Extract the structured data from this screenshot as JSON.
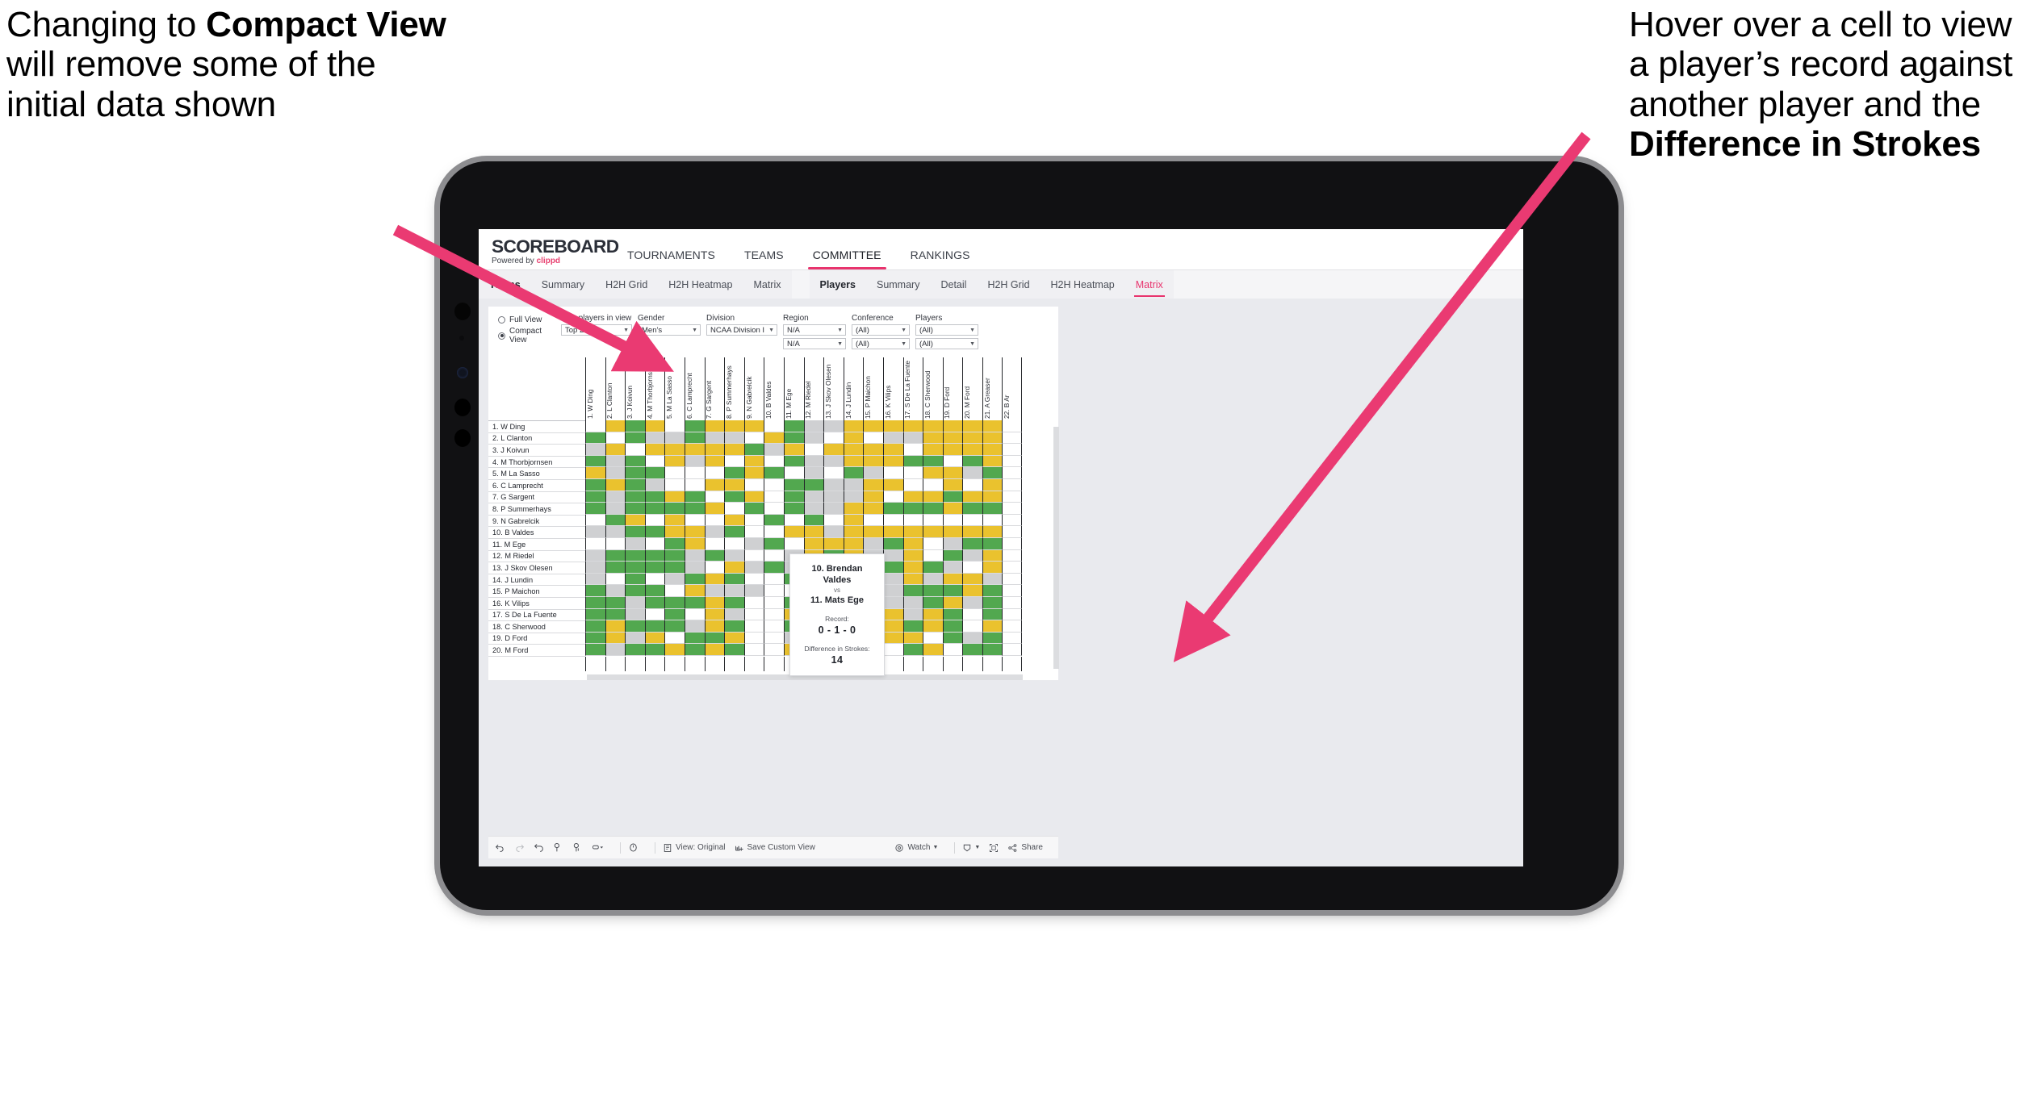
{
  "annotations": {
    "left": {
      "lines": [
        "Changing to ",
        "Compact View",
        " will remove some of the initial data shown"
      ],
      "plain_pre": "Changing to ",
      "bold": "Compact View",
      "plain_post": " will remove some of the initial data shown"
    },
    "right": {
      "plain_pre": "Hover over a cell to view a player’s record against another player and the ",
      "bold": "Difference in Strokes",
      "plain_post": ""
    },
    "arrow_color": "#ea3a72"
  },
  "app": {
    "brand": {
      "name": "SCOREBOARD",
      "powered_prefix": "Powered by ",
      "powered_brand": "clippd"
    },
    "topnav": [
      {
        "label": "TOURNAMENTS",
        "active": false
      },
      {
        "label": "TEAMS",
        "active": false
      },
      {
        "label": "COMMITTEE",
        "active": true
      },
      {
        "label": "RANKINGS",
        "active": false
      }
    ],
    "subnav_teams": [
      {
        "label": "Teams",
        "head": true,
        "selected": false
      },
      {
        "label": "Summary",
        "head": false,
        "selected": false
      },
      {
        "label": "H2H Grid",
        "head": false,
        "selected": false
      },
      {
        "label": "H2H Heatmap",
        "head": false,
        "selected": false
      },
      {
        "label": "Matrix",
        "head": false,
        "selected": false
      }
    ],
    "subnav_players": [
      {
        "label": "Players",
        "head": true,
        "selected": false
      },
      {
        "label": "Summary",
        "head": false,
        "selected": false
      },
      {
        "label": "Detail",
        "head": false,
        "selected": false
      },
      {
        "label": "H2H Grid",
        "head": false,
        "selected": false
      },
      {
        "label": "H2H Heatmap",
        "head": false,
        "selected": false
      },
      {
        "label": "Matrix",
        "head": false,
        "selected": true
      }
    ]
  },
  "filters": {
    "view_modes": [
      {
        "label": "Full View",
        "selected": false
      },
      {
        "label": "Compact View",
        "selected": true
      }
    ],
    "fields": [
      {
        "name": "max_players",
        "label": "Max players in view",
        "value": "Top 25",
        "value2": null
      },
      {
        "name": "gender",
        "label": "Gender",
        "value": "Men’s",
        "value2": null
      },
      {
        "name": "division",
        "label": "Division",
        "value": "NCAA Division I",
        "value2": null
      },
      {
        "name": "region",
        "label": "Region",
        "value": "N/A",
        "value2": "N/A"
      },
      {
        "name": "conference",
        "label": "Conference",
        "value": "(All)",
        "value2": "(All)"
      },
      {
        "name": "players",
        "label": "Players",
        "value": "(All)",
        "value2": "(All)"
      }
    ]
  },
  "matrix": {
    "row_labels": [
      "1. W Ding",
      "2. L Clanton",
      "3. J Koivun",
      "4. M Thorbjornsen",
      "5. M La Sasso",
      "6. C Lamprecht",
      "7. G Sargent",
      "8. P Summerhays",
      "9. N Gabrelcik",
      "10. B Valdes",
      "11. M Ege",
      "12. M Riedel",
      "13. J Skov Olesen",
      "14. J Lundin",
      "15. P Maichon",
      "16. K Vilips",
      "17. S De La Fuente",
      "18. C Sherwood",
      "19. D Ford",
      "20. M Ford"
    ],
    "col_labels": [
      "1. W Ding",
      "2. L Clanton",
      "3. J Koivun",
      "4. M Thorbjornsen",
      "5. M La Sasso",
      "6. C Lamprecht",
      "7. G Sargent",
      "8. P Summerhays",
      "9. N Gabrelcik",
      "10. B Valdes",
      "11. M Ege",
      "12. M Riedel",
      "13. J Skov Olesen",
      "14. J Lundin",
      "15. P Maichon",
      "16. K Vilips",
      "17. S De La Fuente",
      "18. C Sherwood",
      "19. D Ford",
      "20. M Ford",
      "21. A Greaser",
      "22. B Ar"
    ],
    "legend_colors": {
      "win": "#52a84f",
      "loss": "#eac22e",
      "tie": "#cfd0d2",
      "none": "#ffffff"
    },
    "cells": [
      "wygywgyyywgaayyyyyyyy",
      "gwgaagaawygawywaayyyy",
      "aywyyyyygaywyyyywyyyy",
      "gagwyaywywgaayyyggwgy",
      "yagg wwgygwa gawwyyag",
      "gygawwyywwggaayywwywy",
      "gaggygwgywgaaaywyygyy",
      "gaggggywgwgaayygggygg",
      "wgywywwywgwgwywwwwwww",
      "aaggyyagwwyyayyyyyyyy",
      "wwawgywwagwyyyagywagg",
      "aggggagawwaygyaaywgay",
      "aggggawyagaayaygygawy",
      "awgwagygwwggayyayayya",
      "gaggwyaaawwgaayagggyg",
      "ggagggygwwgwgagaagyag",
      "ggawgwyawwyywgyyaygwg",
      "gygggaygwwgywayygygwy",
      "gyaywggywwaygawyywgag",
      "gaggygygwwyaygywgywgg"
    ]
  },
  "tooltip": {
    "player_a": "10. Brendan Valdes",
    "vs": "vs",
    "player_b": "11. Mats Ege",
    "record_label": "Record:",
    "record_value": "0 - 1 - 0",
    "strokes_label": "Difference in Strokes:",
    "strokes_value": "14"
  },
  "toolbar": {
    "items": [
      {
        "name": "undo-icon",
        "label": ""
      },
      {
        "name": "redo-icon",
        "label": ""
      },
      {
        "name": "revert-icon",
        "label": ""
      },
      {
        "name": "refresh-icon",
        "label": ""
      },
      {
        "name": "pause-icon",
        "label": ""
      },
      {
        "name": "highlight-icon",
        "label": ""
      }
    ],
    "view_original": "View: Original",
    "save_custom_view": "Save Custom View",
    "watch": "Watch",
    "share": "Share"
  }
}
